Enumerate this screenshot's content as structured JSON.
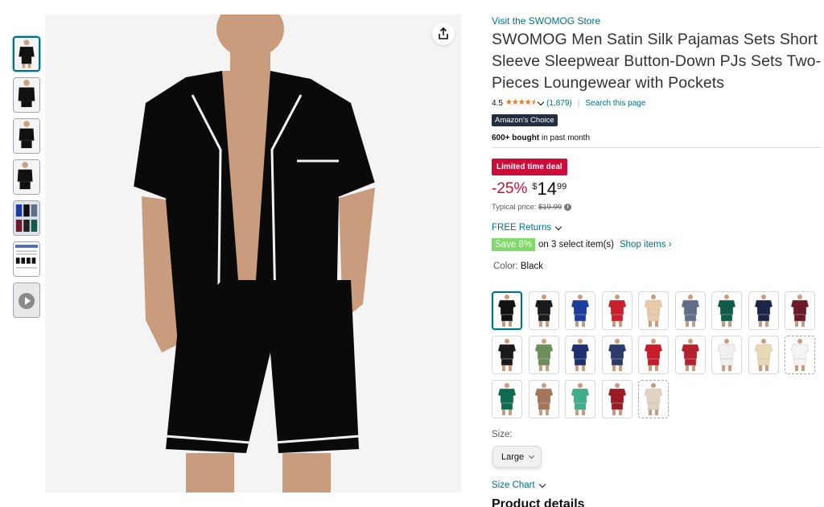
{
  "store_link": "Visit the SWOMOG Store",
  "title": "SWOMOG Men Satin Silk Pajamas Sets Short Sleeve Sleepwear Button-Down PJs Sets Two-Pieces Loungewear with Pockets",
  "rating": {
    "value": "4.5",
    "stars": "★★★★⯨",
    "count": "(1,879)",
    "search_link": "Search this page"
  },
  "badge_choice": "Amazon's Choice",
  "bought": {
    "bold": "600+ bought",
    "rest": " in past month"
  },
  "deal_badge": "Limited time deal",
  "price": {
    "discount": "-25%",
    "currency": "$",
    "whole": "14",
    "fraction": "99",
    "typical_label": "Typical price: ",
    "typical_value": "$19.99"
  },
  "returns": "FREE Returns",
  "save": {
    "badge": "Save 8%",
    "text": "on 3 select item(s)",
    "shop": "Shop items ›"
  },
  "color": {
    "label": "Color: ",
    "value": "Black"
  },
  "swatch_rows": [
    [
      "#111111",
      "#1a1a1a",
      "#1c3d9e",
      "#c8202c",
      "#e8c9a8",
      "#5f6f88",
      "#0f5c4a",
      "#1b2545",
      "#6b1a2a"
    ],
    [
      "#1a1a1a",
      "#6b8f5a",
      "#1d2f6e",
      "#2b3a6b",
      "#c41e2a",
      "#b5202f",
      "#f0f0f0",
      "#e8d8b5",
      "#f5f5f5"
    ],
    [
      "#0e6b4d",
      "#a4775a",
      "#3fae8a",
      "#9b1a24",
      "#e0d2c2"
    ]
  ],
  "size": {
    "label": "Size:",
    "value": "Large"
  },
  "size_chart": "Size Chart",
  "product_details": "Product details",
  "colors": {
    "link": "#007185",
    "deal": "#cc0c39",
    "star": "#de7921",
    "save_green": "#7fda69"
  }
}
